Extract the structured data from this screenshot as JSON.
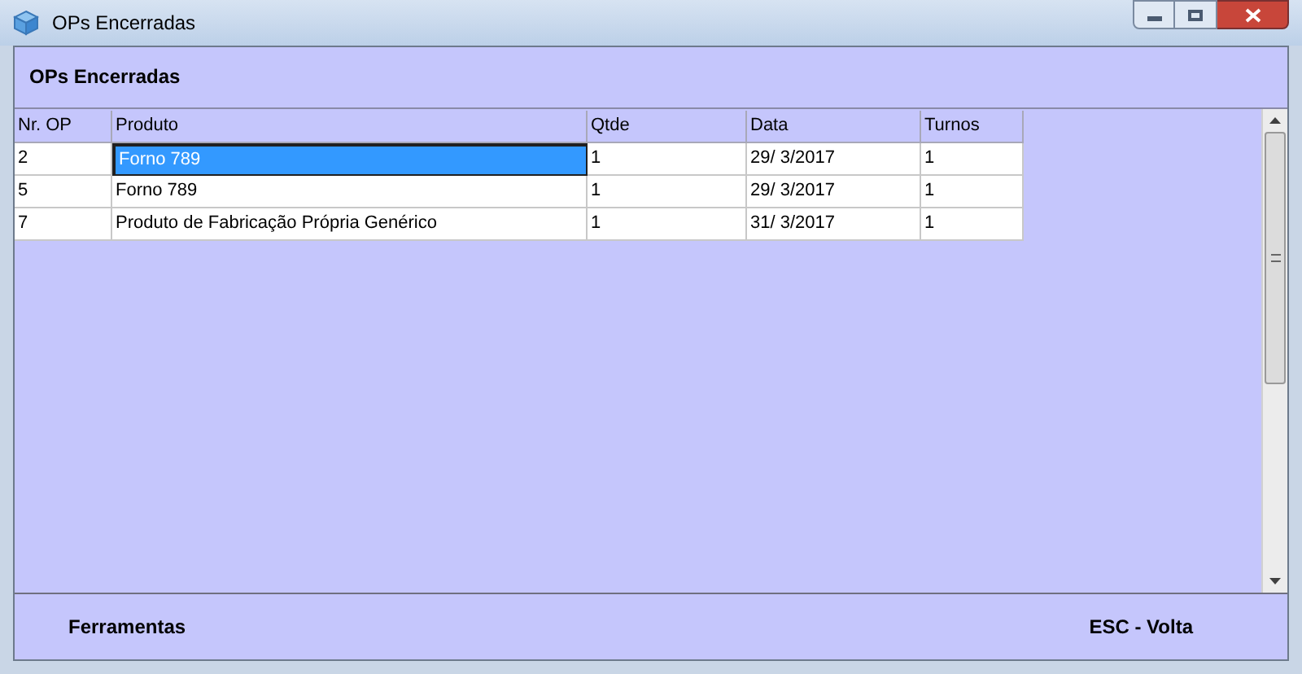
{
  "window": {
    "title": "OPs Encerradas"
  },
  "header": {
    "title": "OPs Encerradas"
  },
  "table": {
    "columns": [
      "Nr. OP",
      "Produto",
      "Qtde",
      "Data",
      "Turnos"
    ],
    "rows": [
      {
        "cells": [
          "2",
          "Forno 789",
          "1",
          "29/ 3/2017",
          "1"
        ],
        "selected": true
      },
      {
        "cells": [
          "5",
          "Forno 789",
          "1",
          "29/ 3/2017",
          "1"
        ],
        "selected": false
      },
      {
        "cells": [
          "7",
          "Produto de Fabricação Própria Genérico",
          "1",
          "31/ 3/2017",
          "1"
        ],
        "selected": false
      }
    ]
  },
  "footer": {
    "left": "Ferramentas",
    "right": "ESC - Volta"
  }
}
